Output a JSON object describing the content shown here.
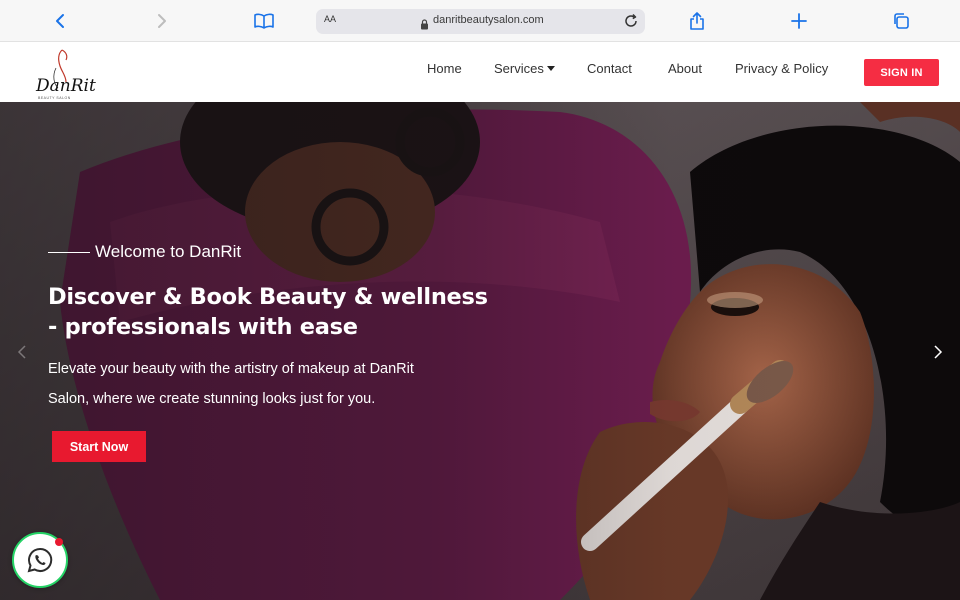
{
  "browser": {
    "text_size_label": "AA",
    "url": "danritbeautysalon.com",
    "icons": [
      "back-icon",
      "forward-icon",
      "bookmarks-icon",
      "lock-icon",
      "reload-icon",
      "share-icon",
      "new-tab-icon",
      "tabs-icon"
    ]
  },
  "nav": {
    "logo_text": "DanRit",
    "logo_tagline": "BEAUTY SALON",
    "items": [
      {
        "label": "Home"
      },
      {
        "label": "Services",
        "has_dropdown": true
      },
      {
        "label": "Contact"
      },
      {
        "label": "About"
      },
      {
        "label": "Privacy & Policy"
      }
    ],
    "signin_label": "SIGN IN"
  },
  "hero": {
    "welcome": "Welcome to DanRit",
    "title_line1": "Discover & Book Beauty & wellness",
    "title_line2": "- professionals with ease",
    "subtitle_line1": "Elevate your beauty with the artistry of makeup at DanRit",
    "subtitle_line2": "Salon, where we create stunning looks just for you.",
    "cta_label": "Start Now",
    "prev_icon": "chevron-left-icon",
    "next_icon": "chevron-right-icon"
  },
  "floating": {
    "whatsapp_icon": "whatsapp-icon",
    "badge": "notification-dot"
  },
  "colors": {
    "accent": "#f52d43",
    "cta": "#e8192f",
    "whatsapp": "#25d366",
    "browser_blue": "#1a73e8"
  }
}
